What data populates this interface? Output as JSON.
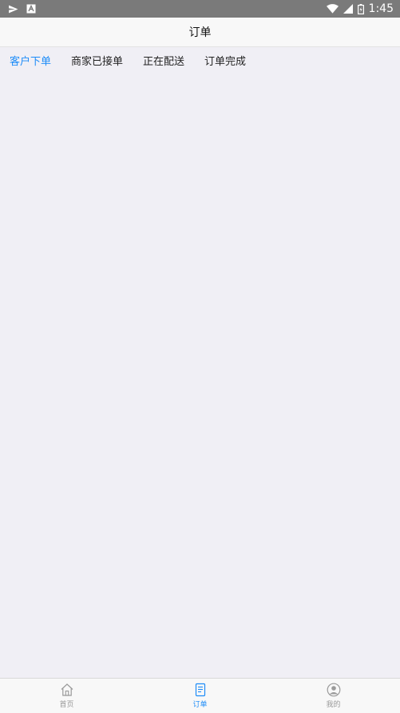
{
  "status_bar": {
    "time": "1:45",
    "left_icons": [
      "send-icon",
      "a-icon"
    ],
    "right_icons": [
      "wifi-icon",
      "cell-signal-icon",
      "battery-icon"
    ]
  },
  "header": {
    "title": "订单"
  },
  "tabs": [
    {
      "label": "客户下单",
      "active": true
    },
    {
      "label": "商家已接单",
      "active": false
    },
    {
      "label": "正在配送",
      "active": false
    },
    {
      "label": "订单完成",
      "active": false
    }
  ],
  "bottom_nav": [
    {
      "label": "首页",
      "icon": "home-icon",
      "active": false
    },
    {
      "label": "订单",
      "icon": "order-icon",
      "active": true
    },
    {
      "label": "我的",
      "icon": "profile-icon",
      "active": false
    }
  ],
  "colors": {
    "accent": "#1d8cf8",
    "background": "#f0eff5",
    "status_bar": "#7a7a7a",
    "inactive": "#999999"
  }
}
